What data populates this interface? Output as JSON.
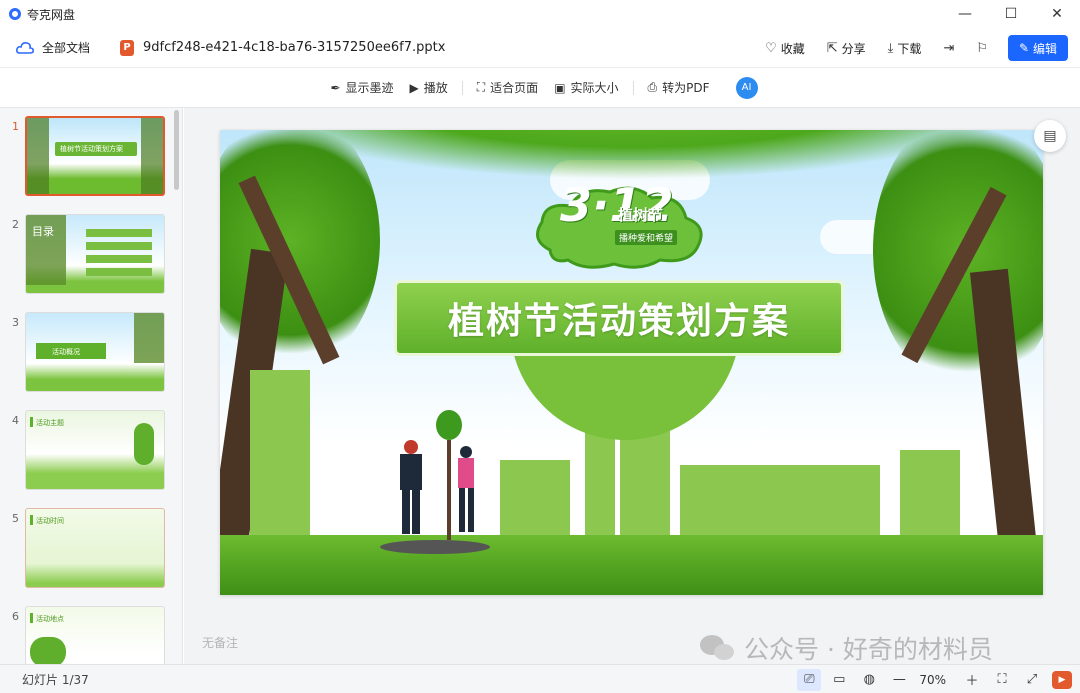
{
  "app": {
    "name": "夸克网盘"
  },
  "window": {
    "minimize": "—",
    "maximize": "☐",
    "close": "✕"
  },
  "header": {
    "all_docs": "全部文档",
    "file_badge": "P",
    "file_name": "9dfcf248-e421-4c18-ba76-3157250ee6f7.pptx",
    "actions": [
      {
        "icon": "♡",
        "label": "收藏"
      },
      {
        "icon": "⇱",
        "label": "分享"
      },
      {
        "icon": "⤓",
        "label": "下载"
      },
      {
        "icon": "⇥",
        "label": ""
      },
      {
        "icon": "⚐",
        "label": ""
      }
    ],
    "edit_label": "编辑"
  },
  "toolbar": {
    "ink": "显示墨迹",
    "play": "播放",
    "fit_page": "适合页面",
    "actual_size": "实际大小",
    "to_pdf": "转为PDF",
    "ai": "AI"
  },
  "thumbnails": [
    {
      "num": "1",
      "text": "植树节活动策划方案",
      "active": true
    },
    {
      "num": "2",
      "text": "目录",
      "active": false
    },
    {
      "num": "3",
      "text": "活动概况",
      "active": false
    },
    {
      "num": "4",
      "text": "活动主题",
      "active": false
    },
    {
      "num": "5",
      "text": "活动时间",
      "active": false
    },
    {
      "num": "6",
      "text": "活动地点",
      "active": false
    }
  ],
  "slide": {
    "logo_number": "3·12",
    "logo_name": "植树节",
    "logo_sub": "播种爱和希望",
    "title": "植树节活动策划方案"
  },
  "notes": {
    "placeholder": "无备注"
  },
  "statusbar": {
    "slide_count": "幻灯片 1/37",
    "zoom": "70%"
  },
  "watermark": {
    "text": "公众号 · 好奇的材料员"
  },
  "colors": {
    "accent": "#1a66ff",
    "pptx": "#e2592d",
    "green": "#5fb02a"
  }
}
